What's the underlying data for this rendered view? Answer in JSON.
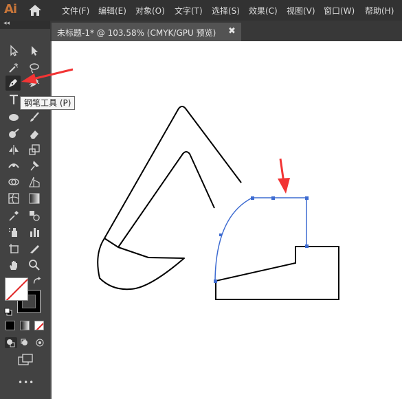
{
  "app": {
    "logo_text": "Ai"
  },
  "menu": {
    "items": [
      "文件(F)",
      "编辑(E)",
      "对象(O)",
      "文字(T)",
      "选择(S)",
      "效果(C)",
      "视图(V)",
      "窗口(W)",
      "帮助(H)"
    ]
  },
  "document": {
    "tab_title": "未标题-1* @ 103.58% (CMYK/GPU 预览)",
    "close_glyph": "✖"
  },
  "tooltip": {
    "text": "钢笔工具 (P)"
  },
  "tools": {
    "active": "pen-tool",
    "names": [
      "selection-tool",
      "direct-selection-tool",
      "magic-wand-tool",
      "lasso-tool",
      "pen-tool",
      "curvature-tool",
      "type-tool",
      "line-segment-tool",
      "ellipse-tool",
      "paintbrush-tool",
      "shaper-tool",
      "eraser-tool",
      "reflect-tool",
      "scale-tool",
      "width-tool",
      "puppet-warp-tool",
      "shape-builder-tool",
      "perspective-grid-tool",
      "mesh-tool",
      "gradient-tool",
      "eyedropper-tool",
      "blend-tool",
      "symbol-sprayer-tool",
      "column-graph-tool",
      "artboard-tool",
      "slice-tool",
      "hand-tool",
      "zoom-tool"
    ]
  },
  "colors": {
    "accent_orange": "#c8763a",
    "selection_blue": "#3d6bd1",
    "annotation_red": "#f23434"
  },
  "more_tools_label": "•••"
}
